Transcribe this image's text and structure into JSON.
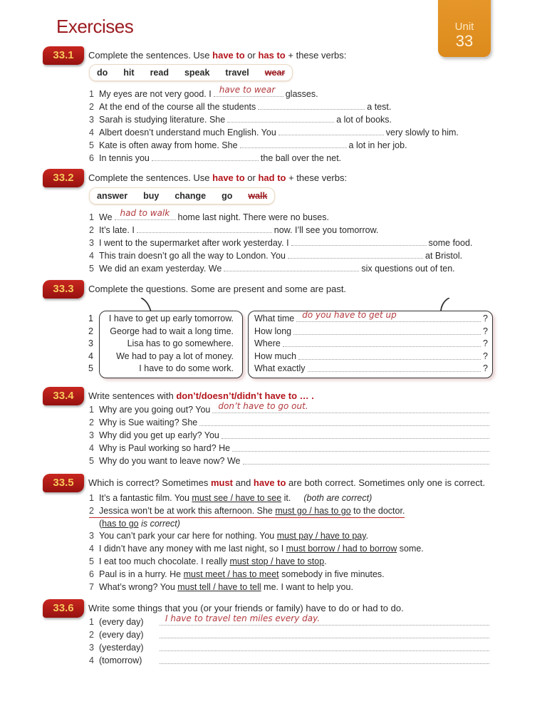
{
  "page_title": "Exercises",
  "unit": {
    "label": "Unit",
    "number": "33"
  },
  "ex1": {
    "badge": "33.1",
    "instr_pre": "Complete the sentences.  Use ",
    "hl1": "have to",
    "mid": " or ",
    "hl2": "has to",
    "instr_post": " + these verbs:",
    "words": [
      "do",
      "hit",
      "read",
      "speak",
      "travel"
    ],
    "struck_word": "wear",
    "items": [
      {
        "n": "1",
        "pre": "My eyes are not very good.  I",
        "answer": "have to wear",
        "post": "glasses."
      },
      {
        "n": "2",
        "pre": "At the end of the course all the students",
        "answer": "",
        "post": "a test."
      },
      {
        "n": "3",
        "pre": "Sarah is studying literature.  She",
        "answer": "",
        "post": "a lot of books."
      },
      {
        "n": "4",
        "pre": "Albert doesn’t understand much English.  You",
        "answer": "",
        "post": "very slowly to him."
      },
      {
        "n": "5",
        "pre": "Kate is often away from home.  She",
        "answer": "",
        "post": "a lot in her job."
      },
      {
        "n": "6",
        "pre": "In tennis you",
        "answer": "",
        "post": "the ball over the net."
      }
    ]
  },
  "ex2": {
    "badge": "33.2",
    "instr_pre": "Complete the sentences.  Use ",
    "hl1": "have to",
    "mid": " or ",
    "hl2": "had to",
    "instr_post": " + these verbs:",
    "words": [
      "answer",
      "buy",
      "change",
      "go"
    ],
    "struck_word": "walk",
    "items": [
      {
        "n": "1",
        "pre": "We",
        "answer": "had to walk",
        "post": "home last night.  There were no buses."
      },
      {
        "n": "2",
        "pre": "It’s late.  I",
        "answer": "",
        "post": "now.  I’ll see you tomorrow."
      },
      {
        "n": "3",
        "pre": "I went to the supermarket after work yesterday.  I",
        "answer": "",
        "post": "some food."
      },
      {
        "n": "4",
        "pre": "This train doesn’t go all the way to London.  You",
        "answer": "",
        "post": "at Bristol."
      },
      {
        "n": "5",
        "pre": "We did an exam yesterday.  We",
        "answer": "",
        "post": "six questions out of ten."
      }
    ]
  },
  "ex3": {
    "badge": "33.3",
    "instr": "Complete the questions.  Some are present and some are past.",
    "statements": [
      {
        "n": "1",
        "text": "I have to get up early tomorrow."
      },
      {
        "n": "2",
        "text": "George had to wait a long time."
      },
      {
        "n": "3",
        "text": "Lisa has to go somewhere."
      },
      {
        "n": "4",
        "text": "We had to pay a lot of money."
      },
      {
        "n": "5",
        "text": "I have to do some work."
      }
    ],
    "questions": [
      {
        "pre": "What time",
        "answer": "do you have to get up",
        "end": "?"
      },
      {
        "pre": "How long",
        "answer": "",
        "end": "?"
      },
      {
        "pre": "Where",
        "answer": "",
        "end": "?"
      },
      {
        "pre": "How much",
        "answer": "",
        "end": "?"
      },
      {
        "pre": "What exactly",
        "answer": "",
        "end": "?"
      }
    ]
  },
  "ex4": {
    "badge": "33.4",
    "instr_pre": "Write sentences with ",
    "hl": "don’t/doesn’t/didn’t have to … .",
    "items": [
      {
        "n": "1",
        "pre": "Why are you going out?  You",
        "answer": "don’t have to go out."
      },
      {
        "n": "2",
        "pre": "Why is Sue waiting?  She",
        "answer": ""
      },
      {
        "n": "3",
        "pre": "Why did you get up early?  You",
        "answer": ""
      },
      {
        "n": "4",
        "pre": "Why is Paul working so hard?  He",
        "answer": ""
      },
      {
        "n": "5",
        "pre": "Why do you want to leave now?  We",
        "answer": ""
      }
    ]
  },
  "ex5": {
    "badge": "33.5",
    "instr_pre": "Which is correct?  Sometimes ",
    "hl1": "must",
    "mid": " and ",
    "hl2": "have to",
    "instr_post": " are both correct.  Sometimes only one is correct.",
    "items": [
      {
        "n": "1",
        "pre": "It’s a fantastic film.  You ",
        "choice": "must see / have to see",
        "post": " it.",
        "note": "(both are correct)"
      },
      {
        "n": "2",
        "pre": "Jessica won’t be at work this afternoon.  She ",
        "choice": " must go  / has to go",
        "post": " to the doctor."
      },
      {
        "n": "3",
        "pre": "You can’t park your car here for nothing.  You ",
        "choice": "must pay / have to pay",
        "post": "."
      },
      {
        "n": "4",
        "pre": "I didn’t have any money with me last night, so I ",
        "choice": "must borrow / had to borrow",
        "post": " some."
      },
      {
        "n": "5",
        "pre": "I eat too much chocolate.  I really ",
        "choice": "must stop / have to stop",
        "post": "."
      },
      {
        "n": "6",
        "pre": "Paul is in a hurry.  He ",
        "choice": "must meet / has to meet",
        "post": " somebody in five minutes."
      },
      {
        "n": "7",
        "pre": "What’s wrong?  You ",
        "choice": "must tell / have to tell",
        "post": " me.  I want to help you."
      }
    ],
    "note2_open": "(",
    "note2_u": "has to go",
    "note2_rest": " is correct)"
  },
  "ex6": {
    "badge": "33.6",
    "instr": "Write some things that you (or your friends or family) have to do or had to do.",
    "items": [
      {
        "n": "1",
        "label": "(every day)",
        "answer": "I have to travel ten miles every day."
      },
      {
        "n": "2",
        "label": "(every day)",
        "answer": ""
      },
      {
        "n": "3",
        "label": "(yesterday)",
        "answer": ""
      },
      {
        "n": "4",
        "label": "(tomorrow)",
        "answer": ""
      }
    ]
  }
}
